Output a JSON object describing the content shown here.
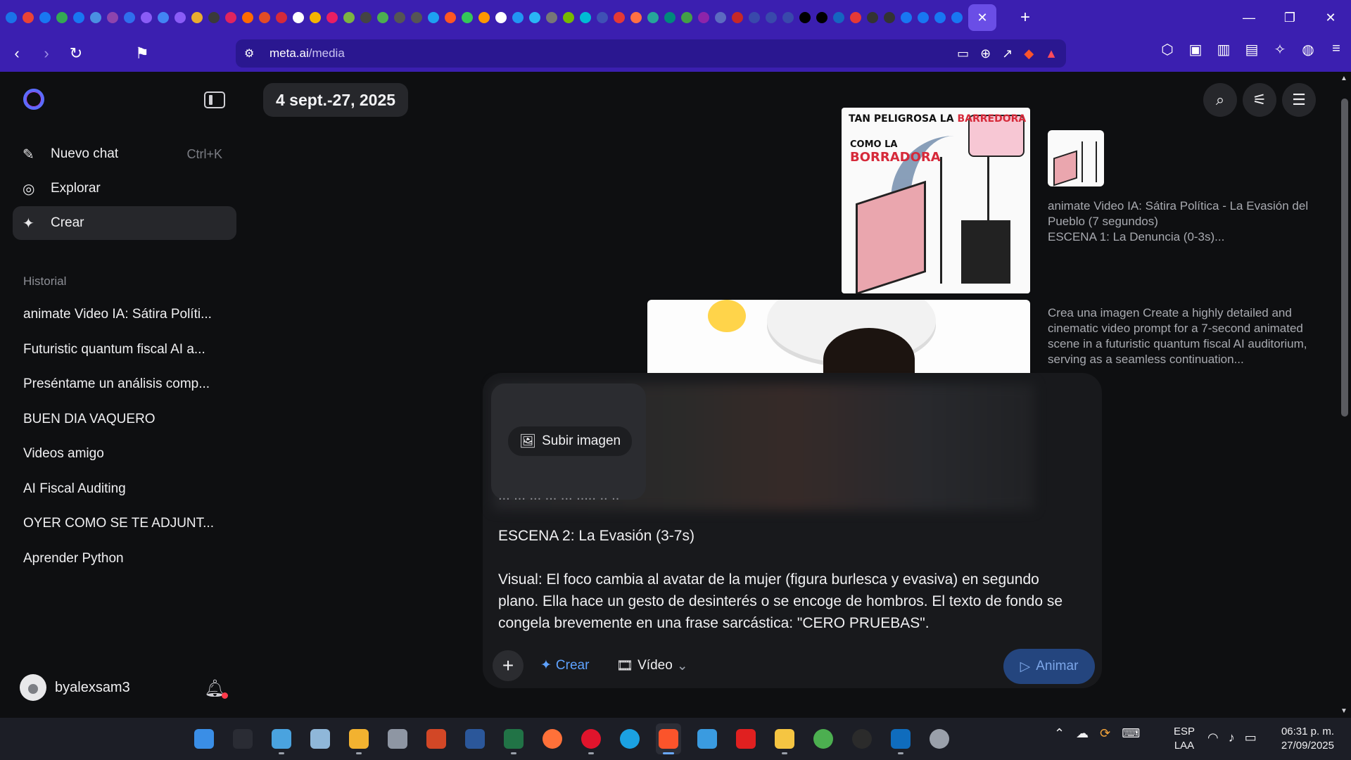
{
  "browser": {
    "url_domain": "meta.ai",
    "url_path": "/media",
    "tab_colors": [
      "#1a73e8",
      "#ea4335",
      "#1877f2",
      "#34a853",
      "#1877f2",
      "#4a90e2",
      "#8e44ad",
      "#2f6fed",
      "#8a5cf6",
      "#4285f4",
      "#8a5cf6",
      "#e9ad2f",
      "#3a3a3a",
      "#e0245e",
      "#ff6a00",
      "#e34c26",
      "#d62a3a",
      "#ffffff",
      "#f4b400",
      "#e91e63",
      "#7cb342",
      "#444444",
      "#4caf50",
      "#555555",
      "#555555",
      "#1da1f2",
      "#ff5722",
      "#34c759",
      "#ff9800",
      "#ffffff",
      "#2196f3",
      "#29b6f6",
      "#777777",
      "#76b900",
      "#00bcd4",
      "#3f51b5",
      "#e53935",
      "#ff7043",
      "#26a69a",
      "#00897b",
      "#43a047",
      "#8e24aa",
      "#5c6bc0",
      "#c62828",
      "#3949ab",
      "#3949ab",
      "#3949ab",
      "#000000",
      "#000000",
      "#1565c0",
      "#e53935",
      "#333333",
      "#333333",
      "#1877f2",
      "#1877f2",
      "#1877f2",
      "#1877f2"
    ],
    "close_active_tab": "✕",
    "new_tab": "+"
  },
  "sidebar": {
    "menu": [
      {
        "icon": "✎",
        "label": "Nuevo chat",
        "shortcut": "Ctrl+K"
      },
      {
        "icon": "◎",
        "label": "Explorar",
        "shortcut": ""
      },
      {
        "icon": "✦",
        "label": "Crear",
        "shortcut": ""
      }
    ],
    "history_title": "Historial",
    "history": [
      "animate Video IA: Sátira Políti...",
      "Futuristic quantum fiscal AI a...",
      "Preséntame un análisis comp...",
      "BUEN DIA VAQUERO",
      "Videos amigo",
      "AI Fiscal Auditing",
      "OYER COMO SE TE ADJUNT...",
      "Aprender Python"
    ],
    "username": "byalexsam3"
  },
  "main": {
    "date_range": "4 sept.-27, 2025",
    "cartoon": {
      "title_a": "TAN PELIGROSA LA ",
      "title_b": "BARREDORA",
      "sub_a": "COMO LA",
      "sub_b": "BORRADORA"
    },
    "desc1": "animate Video IA: Sátira Política - La Evasión del Pueblo (7 segundos)\nESCENA 1: La Denuncia (0-3s)...",
    "desc2": "Crea una imagen Create a highly detailed and cinematic video prompt for a 7-second animated scene in a futuristic quantum fiscal AI auditorium, serving as a seamless continuation..."
  },
  "composer": {
    "upload_label": "Subir imagen",
    "cut_line": "... ... ... ... ... ..... .. ..",
    "scene_title": "ESCENA 2: La Evasión (3-7s)",
    "scene_body": "Visual: El foco cambia al avatar de la mujer (figura burlesca y evasiva) en segundo plano. Ella hace un gesto de desinterés o se encoge de hombros. El texto de fondo se congela brevemente en una frase sarcástica: \"CERO PRUEBAS\".",
    "create_chip": "Crear",
    "video_chip": "Vídeo",
    "animate_button": "Animar"
  },
  "taskbar": {
    "apps": [
      {
        "name": "windows-start",
        "color": "#3a8ee6"
      },
      {
        "name": "search",
        "color": "#2a2c34"
      },
      {
        "name": "notepad",
        "color": "#4aa3df"
      },
      {
        "name": "photos",
        "color": "#8fb7d9"
      },
      {
        "name": "tool",
        "color": "#f2b230"
      },
      {
        "name": "settings",
        "color": "#8e96a3"
      },
      {
        "name": "powerpoint",
        "color": "#d24726"
      },
      {
        "name": "word",
        "color": "#2b579a"
      },
      {
        "name": "excel",
        "color": "#217346"
      },
      {
        "name": "firefox",
        "color": "#ff7139"
      },
      {
        "name": "opera",
        "color": "#e0142c"
      },
      {
        "name": "edge",
        "color": "#1ba1e2"
      },
      {
        "name": "brave",
        "color": "#fb542b"
      },
      {
        "name": "app",
        "color": "#3a9be0"
      },
      {
        "name": "acrobat",
        "color": "#e02020"
      },
      {
        "name": "explorer",
        "color": "#f5c542"
      },
      {
        "name": "maps",
        "color": "#4caf50"
      },
      {
        "name": "chatgpt",
        "color": "#2b2b2b"
      },
      {
        "name": "outlook",
        "color": "#0f6cbd"
      },
      {
        "name": "media",
        "color": "#9aa0aa"
      }
    ],
    "lang_top": "ESP",
    "lang_bottom": "LAA",
    "time": "06:31 p. m.",
    "date": "27/09/2025"
  }
}
